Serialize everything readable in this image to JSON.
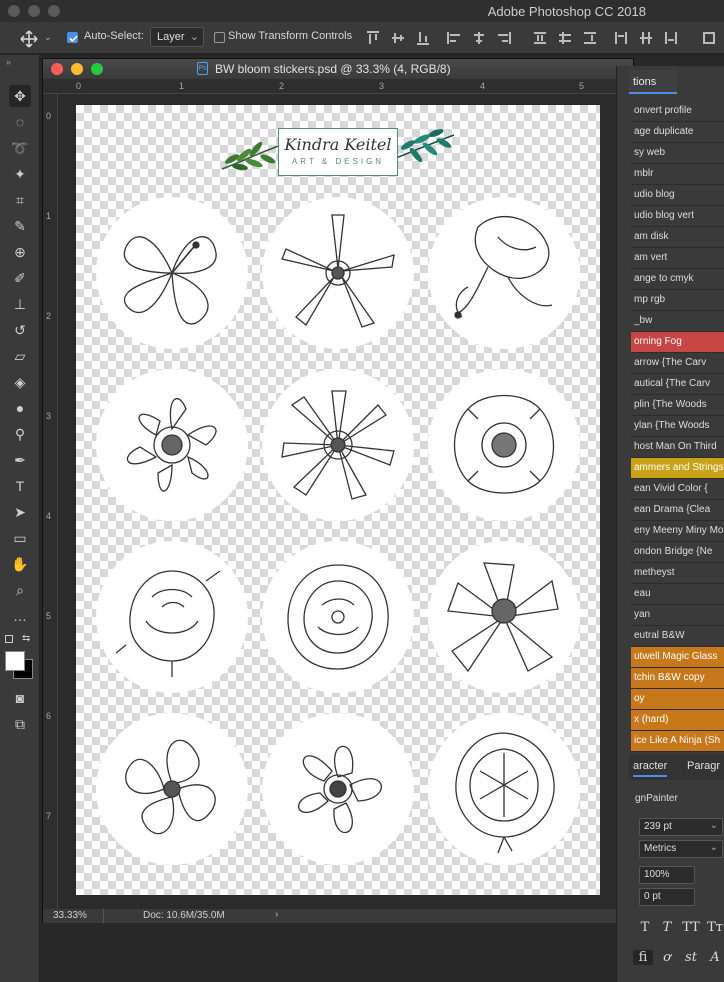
{
  "app": {
    "title": "Adobe Photoshop CC 2018"
  },
  "options_bar": {
    "auto_select_label": "Auto-Select:",
    "auto_select_target": "Layer",
    "show_transform_label": "Show Transform Controls"
  },
  "document": {
    "title": "BW bloom stickers.psd @ 33.3% (4, RGB/8)",
    "badge": "Ps",
    "ruler_h": [
      "0",
      "1",
      "2",
      "3",
      "4",
      "5"
    ],
    "ruler_v": [
      "0",
      "1",
      "2",
      "3",
      "4",
      "5",
      "6",
      "7"
    ],
    "zoom": "33.33%",
    "doc_size": "Doc: 10.6M/35.0M",
    "logo_name": "Kindra Keitel",
    "logo_sub": "ART & DESIGN"
  },
  "actions_panel": {
    "tab_label": "tions",
    "items": [
      {
        "label": "onvert profile",
        "color": "none"
      },
      {
        "label": "age duplicate",
        "color": "none"
      },
      {
        "label": "sy web",
        "color": "none"
      },
      {
        "label": "mblr",
        "color": "none"
      },
      {
        "label": "udio blog",
        "color": "none"
      },
      {
        "label": "udio blog vert",
        "color": "none"
      },
      {
        "label": "am disk",
        "color": "none"
      },
      {
        "label": "am vert",
        "color": "none"
      },
      {
        "label": "ange to cmyk",
        "color": "none"
      },
      {
        "label": "mp rgb",
        "color": "none"
      },
      {
        "label": "_bw",
        "color": "none"
      },
      {
        "label": "orning Fog",
        "color": "red"
      },
      {
        "label": "arrow    {The Carv",
        "color": "none"
      },
      {
        "label": "autical   {The Carv",
        "color": "none"
      },
      {
        "label": "plin   {The Woods",
        "color": "none"
      },
      {
        "label": "ylan    {The Woods",
        "color": "none"
      },
      {
        "label": "host Man On Third",
        "color": "none"
      },
      {
        "label": "ammers and Strings",
        "color": "yellow"
      },
      {
        "label": "ean Vivid Color    {",
        "color": "none"
      },
      {
        "label": "ean Drama    {Clea",
        "color": "none"
      },
      {
        "label": "eny Meeny Miny Mo",
        "color": "none"
      },
      {
        "label": "ondon Bridge    {Ne",
        "color": "none"
      },
      {
        "label": "metheyst",
        "color": "none"
      },
      {
        "label": "eau",
        "color": "none"
      },
      {
        "label": "yan",
        "color": "none"
      },
      {
        "label": "eutral B&W",
        "color": "none"
      },
      {
        "label": "utwell Magic Glass",
        "color": "orange"
      },
      {
        "label": "tchin B&W copy",
        "color": "orange"
      },
      {
        "label": "oy",
        "color": "orange"
      },
      {
        "label": "x (hard)",
        "color": "orange"
      },
      {
        "label": "ice Like A Ninja (Sh",
        "color": "orange"
      }
    ]
  },
  "character_panel": {
    "tab_character": "aracter",
    "tab_paragraph": "Paragr",
    "font": "gnPainter",
    "size": "239 pt",
    "kerning": "Metrics",
    "scale": "100%",
    "baseline": "0 pt",
    "format_row1": [
      "T",
      "T",
      "TT",
      "Tт"
    ],
    "format_row2": [
      "fi",
      "ơ",
      "st",
      "A"
    ]
  },
  "colors": {
    "accent": "#4b8fe0",
    "red_action": "#c74545",
    "yellow_action": "#c9a21a",
    "orange_action": "#c7781a"
  }
}
